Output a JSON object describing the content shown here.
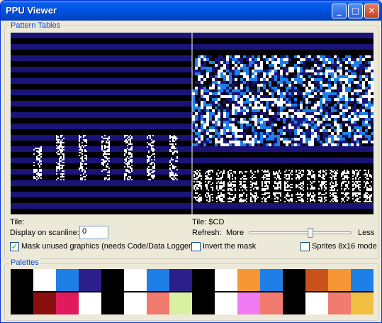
{
  "window": {
    "title": "PPU Viewer"
  },
  "title_buttons": {
    "minimize": "_",
    "maximize": "□",
    "close": "✕"
  },
  "pattern_tables": {
    "legend": "Pattern Tables",
    "left": {
      "tile_label": "Tile:",
      "background": "#1a1478"
    },
    "right": {
      "tile_label": "Tile: $CD"
    }
  },
  "scanline": {
    "label": "Display on scanline:",
    "value": "0"
  },
  "refresh": {
    "label": "Refresh:",
    "more": "More",
    "less": "Less",
    "value_fraction": 0.6
  },
  "options": {
    "mask_unused": {
      "label": "Mask unused graphics (needs Code/Data Logger)",
      "checked": true
    },
    "invert_mask": {
      "label": "Invert the mask",
      "checked": false
    },
    "sprites_8x16": {
      "label": "Sprites 8x16 mode",
      "checked": false
    }
  },
  "palettes": {
    "legend": "Palettes",
    "row1": [
      "#000000",
      "#ffffff",
      "#1e7fe6",
      "#2d1f8a",
      "#000000",
      "#ffffff",
      "#1e7fe6",
      "#2d1f8a",
      "#000000",
      "#ffffff",
      "#f79634",
      "#1e7fe6",
      "#000000",
      "#c8521a",
      "#f79634",
      "#1e7fe6"
    ],
    "row2": [
      "#000000",
      "#8a1010",
      "#e01a5e",
      "#ffffff",
      "#000000",
      "#ffffff",
      "#f07b6e",
      "#d8f0a0",
      "#000000",
      "#ffffff",
      "#f07bf0",
      "#f07b6e",
      "#000000",
      "#ffffff",
      "#f07b6e",
      "#f0c040"
    ]
  }
}
